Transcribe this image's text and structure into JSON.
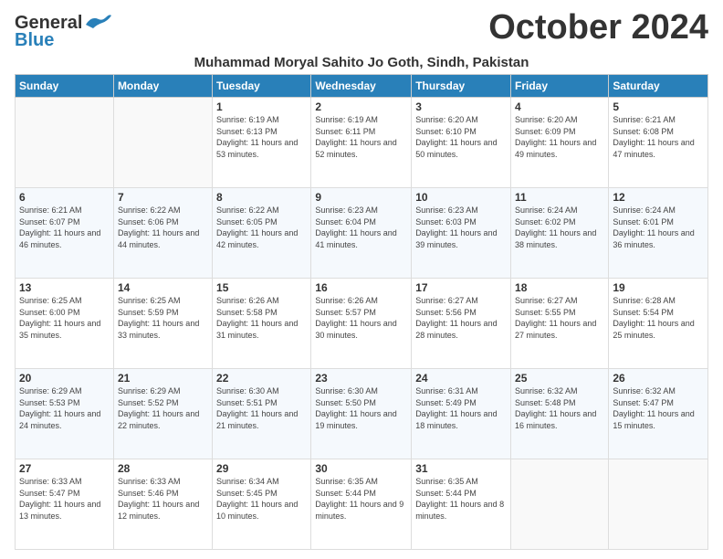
{
  "header": {
    "logo_line1": "General",
    "logo_line2": "Blue",
    "month": "October 2024",
    "location": "Muhammad Moryal Sahito Jo Goth, Sindh, Pakistan"
  },
  "days_of_week": [
    "Sunday",
    "Monday",
    "Tuesday",
    "Wednesday",
    "Thursday",
    "Friday",
    "Saturday"
  ],
  "weeks": [
    [
      {
        "day": "",
        "sunrise": "",
        "sunset": "",
        "daylight": ""
      },
      {
        "day": "",
        "sunrise": "",
        "sunset": "",
        "daylight": ""
      },
      {
        "day": "1",
        "sunrise": "Sunrise: 6:19 AM",
        "sunset": "Sunset: 6:13 PM",
        "daylight": "Daylight: 11 hours and 53 minutes."
      },
      {
        "day": "2",
        "sunrise": "Sunrise: 6:19 AM",
        "sunset": "Sunset: 6:11 PM",
        "daylight": "Daylight: 11 hours and 52 minutes."
      },
      {
        "day": "3",
        "sunrise": "Sunrise: 6:20 AM",
        "sunset": "Sunset: 6:10 PM",
        "daylight": "Daylight: 11 hours and 50 minutes."
      },
      {
        "day": "4",
        "sunrise": "Sunrise: 6:20 AM",
        "sunset": "Sunset: 6:09 PM",
        "daylight": "Daylight: 11 hours and 49 minutes."
      },
      {
        "day": "5",
        "sunrise": "Sunrise: 6:21 AM",
        "sunset": "Sunset: 6:08 PM",
        "daylight": "Daylight: 11 hours and 47 minutes."
      }
    ],
    [
      {
        "day": "6",
        "sunrise": "Sunrise: 6:21 AM",
        "sunset": "Sunset: 6:07 PM",
        "daylight": "Daylight: 11 hours and 46 minutes."
      },
      {
        "day": "7",
        "sunrise": "Sunrise: 6:22 AM",
        "sunset": "Sunset: 6:06 PM",
        "daylight": "Daylight: 11 hours and 44 minutes."
      },
      {
        "day": "8",
        "sunrise": "Sunrise: 6:22 AM",
        "sunset": "Sunset: 6:05 PM",
        "daylight": "Daylight: 11 hours and 42 minutes."
      },
      {
        "day": "9",
        "sunrise": "Sunrise: 6:23 AM",
        "sunset": "Sunset: 6:04 PM",
        "daylight": "Daylight: 11 hours and 41 minutes."
      },
      {
        "day": "10",
        "sunrise": "Sunrise: 6:23 AM",
        "sunset": "Sunset: 6:03 PM",
        "daylight": "Daylight: 11 hours and 39 minutes."
      },
      {
        "day": "11",
        "sunrise": "Sunrise: 6:24 AM",
        "sunset": "Sunset: 6:02 PM",
        "daylight": "Daylight: 11 hours and 38 minutes."
      },
      {
        "day": "12",
        "sunrise": "Sunrise: 6:24 AM",
        "sunset": "Sunset: 6:01 PM",
        "daylight": "Daylight: 11 hours and 36 minutes."
      }
    ],
    [
      {
        "day": "13",
        "sunrise": "Sunrise: 6:25 AM",
        "sunset": "Sunset: 6:00 PM",
        "daylight": "Daylight: 11 hours and 35 minutes."
      },
      {
        "day": "14",
        "sunrise": "Sunrise: 6:25 AM",
        "sunset": "Sunset: 5:59 PM",
        "daylight": "Daylight: 11 hours and 33 minutes."
      },
      {
        "day": "15",
        "sunrise": "Sunrise: 6:26 AM",
        "sunset": "Sunset: 5:58 PM",
        "daylight": "Daylight: 11 hours and 31 minutes."
      },
      {
        "day": "16",
        "sunrise": "Sunrise: 6:26 AM",
        "sunset": "Sunset: 5:57 PM",
        "daylight": "Daylight: 11 hours and 30 minutes."
      },
      {
        "day": "17",
        "sunrise": "Sunrise: 6:27 AM",
        "sunset": "Sunset: 5:56 PM",
        "daylight": "Daylight: 11 hours and 28 minutes."
      },
      {
        "day": "18",
        "sunrise": "Sunrise: 6:27 AM",
        "sunset": "Sunset: 5:55 PM",
        "daylight": "Daylight: 11 hours and 27 minutes."
      },
      {
        "day": "19",
        "sunrise": "Sunrise: 6:28 AM",
        "sunset": "Sunset: 5:54 PM",
        "daylight": "Daylight: 11 hours and 25 minutes."
      }
    ],
    [
      {
        "day": "20",
        "sunrise": "Sunrise: 6:29 AM",
        "sunset": "Sunset: 5:53 PM",
        "daylight": "Daylight: 11 hours and 24 minutes."
      },
      {
        "day": "21",
        "sunrise": "Sunrise: 6:29 AM",
        "sunset": "Sunset: 5:52 PM",
        "daylight": "Daylight: 11 hours and 22 minutes."
      },
      {
        "day": "22",
        "sunrise": "Sunrise: 6:30 AM",
        "sunset": "Sunset: 5:51 PM",
        "daylight": "Daylight: 11 hours and 21 minutes."
      },
      {
        "day": "23",
        "sunrise": "Sunrise: 6:30 AM",
        "sunset": "Sunset: 5:50 PM",
        "daylight": "Daylight: 11 hours and 19 minutes."
      },
      {
        "day": "24",
        "sunrise": "Sunrise: 6:31 AM",
        "sunset": "Sunset: 5:49 PM",
        "daylight": "Daylight: 11 hours and 18 minutes."
      },
      {
        "day": "25",
        "sunrise": "Sunrise: 6:32 AM",
        "sunset": "Sunset: 5:48 PM",
        "daylight": "Daylight: 11 hours and 16 minutes."
      },
      {
        "day": "26",
        "sunrise": "Sunrise: 6:32 AM",
        "sunset": "Sunset: 5:47 PM",
        "daylight": "Daylight: 11 hours and 15 minutes."
      }
    ],
    [
      {
        "day": "27",
        "sunrise": "Sunrise: 6:33 AM",
        "sunset": "Sunset: 5:47 PM",
        "daylight": "Daylight: 11 hours and 13 minutes."
      },
      {
        "day": "28",
        "sunrise": "Sunrise: 6:33 AM",
        "sunset": "Sunset: 5:46 PM",
        "daylight": "Daylight: 11 hours and 12 minutes."
      },
      {
        "day": "29",
        "sunrise": "Sunrise: 6:34 AM",
        "sunset": "Sunset: 5:45 PM",
        "daylight": "Daylight: 11 hours and 10 minutes."
      },
      {
        "day": "30",
        "sunrise": "Sunrise: 6:35 AM",
        "sunset": "Sunset: 5:44 PM",
        "daylight": "Daylight: 11 hours and 9 minutes."
      },
      {
        "day": "31",
        "sunrise": "Sunrise: 6:35 AM",
        "sunset": "Sunset: 5:44 PM",
        "daylight": "Daylight: 11 hours and 8 minutes."
      },
      {
        "day": "",
        "sunrise": "",
        "sunset": "",
        "daylight": ""
      },
      {
        "day": "",
        "sunrise": "",
        "sunset": "",
        "daylight": ""
      }
    ]
  ]
}
